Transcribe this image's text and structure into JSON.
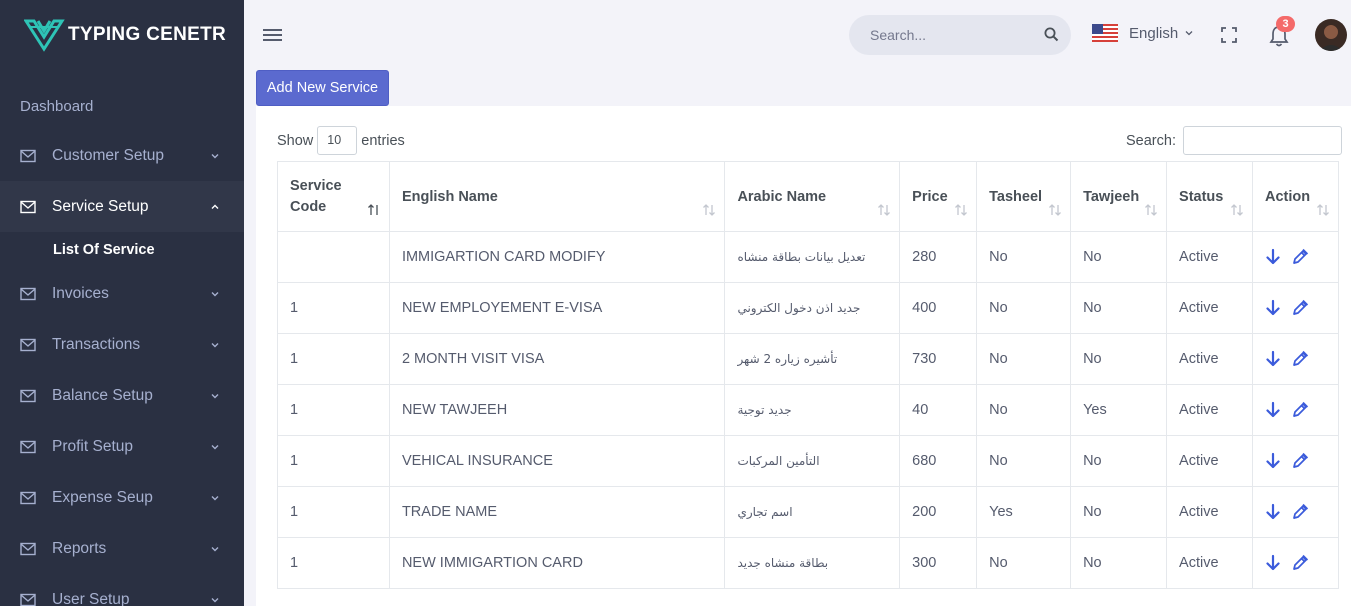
{
  "brand": {
    "name": "TYPING CENETR",
    "color": "#2ec4b6"
  },
  "sidebar": {
    "dashboard": "Dashboard",
    "items": [
      {
        "label": "Customer Setup",
        "icon": "mail-icon",
        "expanded": false
      },
      {
        "label": "Service Setup",
        "icon": "mail-icon",
        "expanded": true
      },
      {
        "label": "Invoices",
        "icon": "mail-icon",
        "expanded": false
      },
      {
        "label": "Transactions",
        "icon": "mail-icon",
        "expanded": false
      },
      {
        "label": "Balance Setup",
        "icon": "mail-icon",
        "expanded": false
      },
      {
        "label": "Profit Setup",
        "icon": "mail-icon",
        "expanded": false
      },
      {
        "label": "Expense Seup",
        "icon": "mail-icon",
        "expanded": false
      },
      {
        "label": "Reports",
        "icon": "mail-icon",
        "expanded": false
      },
      {
        "label": "User Setup",
        "icon": "mail-icon",
        "expanded": false
      }
    ],
    "submenu": {
      "label": "List Of Service"
    }
  },
  "topbar": {
    "search_placeholder": "Search...",
    "language": "English",
    "notification_count": "3"
  },
  "toolbar": {
    "add_label": "Add New Service"
  },
  "table_controls": {
    "show_label": "Show",
    "page_length": "10",
    "entries_label": "entries",
    "search_label": "Search:"
  },
  "table": {
    "headers": [
      "Service Code",
      "English Name",
      "Arabic Name",
      "Price",
      "Tasheel",
      "Tawjeeh",
      "Status",
      "Action"
    ],
    "rows": [
      {
        "code": "",
        "english": "IMMIGARTION CARD MODIFY",
        "arabic": "تعديل بيانات بطاقة منشاه",
        "price": "280",
        "tasheel": "No",
        "tawjeeh": "No",
        "status": "Active"
      },
      {
        "code": "1",
        "english": "NEW EMPLOYEMENT E-VISA",
        "arabic": "جديد اذن دخول الكتروني",
        "price": "400",
        "tasheel": "No",
        "tawjeeh": "No",
        "status": "Active"
      },
      {
        "code": "1",
        "english": "2 MONTH VISIT VISA",
        "arabic": "تأشيره زياره 2 شهر",
        "price": "730",
        "tasheel": "No",
        "tawjeeh": "No",
        "status": "Active"
      },
      {
        "code": "1",
        "english": "NEW TAWJEEH",
        "arabic": "جديد توجية",
        "price": "40",
        "tasheel": "No",
        "tawjeeh": "Yes",
        "status": "Active"
      },
      {
        "code": "1",
        "english": "VEHICAL INSURANCE",
        "arabic": "التأمين المركبات",
        "price": "680",
        "tasheel": "No",
        "tawjeeh": "No",
        "status": "Active"
      },
      {
        "code": "1",
        "english": "TRADE NAME",
        "arabic": "اسم تجاري",
        "price": "200",
        "tasheel": "Yes",
        "tawjeeh": "No",
        "status": "Active"
      },
      {
        "code": "1",
        "english": "NEW IMMIGARTION CARD",
        "arabic": "بطاقة منشاه جديد",
        "price": "300",
        "tasheel": "No",
        "tawjeeh": "No",
        "status": "Active"
      }
    ]
  },
  "colors": {
    "sidebar_bg": "#2a3042",
    "primary": "#5b6acf",
    "action_icon": "#3b5bdb",
    "badge": "#f46a6a"
  }
}
